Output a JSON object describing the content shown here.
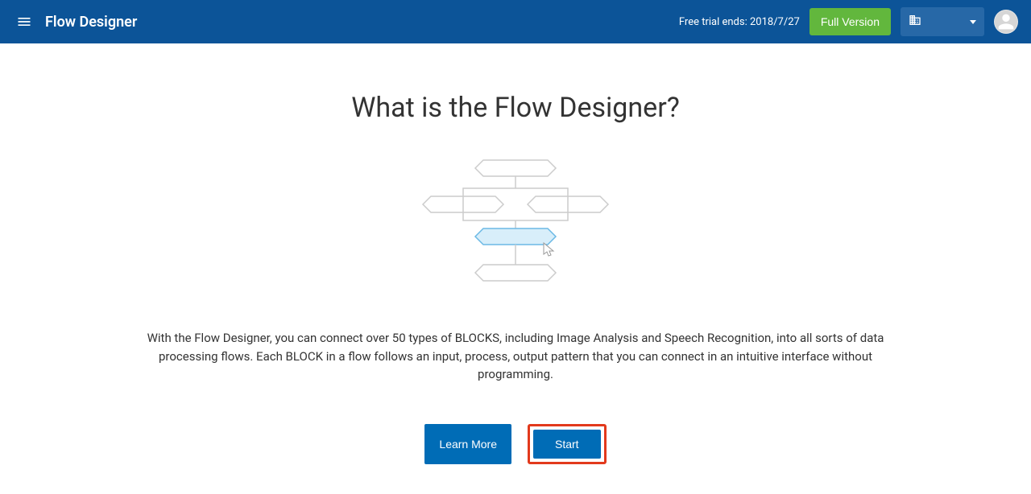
{
  "header": {
    "app_title": "Flow Designer",
    "trial_text": "Free trial ends: 2018/7/27",
    "full_version_label": "Full Version"
  },
  "main": {
    "title": "What is the Flow Designer?",
    "description": "With the Flow Designer, you can connect over 50 types of BLOCKS, including Image Analysis and Speech Recognition, into all sorts of data processing flows. Each BLOCK in a flow follows an input, process, output pattern that you can connect in an intuitive interface without programming.",
    "learn_more_label": "Learn More",
    "start_label": "Start"
  }
}
